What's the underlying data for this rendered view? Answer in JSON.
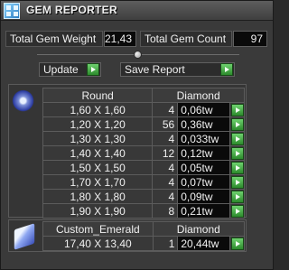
{
  "window": {
    "title": "GEM REPORTER",
    "icon": "gem-reporter-icon"
  },
  "totals": {
    "weight_label": "Total Gem Weight",
    "weight_value": "21,43",
    "count_label": "Total Gem Count",
    "count_value": "97"
  },
  "actions": {
    "update_label": "Update",
    "save_report_label": "Save Report"
  },
  "round_group": {
    "cut": "Round",
    "material": "Diamond",
    "rows": [
      {
        "size": "1,60 X 1,60",
        "count": "4",
        "weight": "0,06tw"
      },
      {
        "size": "1,20 X 1,20",
        "count": "56",
        "weight": "0,36tw"
      },
      {
        "size": "1,30 X 1,30",
        "count": "4",
        "weight": "0,033tw"
      },
      {
        "size": "1,40 X 1,40",
        "count": "12",
        "weight": "0,12tw"
      },
      {
        "size": "1,50 X 1,50",
        "count": "4",
        "weight": "0,05tw"
      },
      {
        "size": "1,70 X 1,70",
        "count": "4",
        "weight": "0,07tw"
      },
      {
        "size": "1,80 X 1,80",
        "count": "4",
        "weight": "0,09tw"
      },
      {
        "size": "1,90 X 1,90",
        "count": "8",
        "weight": "0,21tw"
      }
    ]
  },
  "emerald_group": {
    "cut": "Custom_Emerald",
    "material": "Diamond",
    "rows": [
      {
        "size": "17,40 X 13,40",
        "count": "1",
        "weight": "20,44tw"
      }
    ]
  }
}
